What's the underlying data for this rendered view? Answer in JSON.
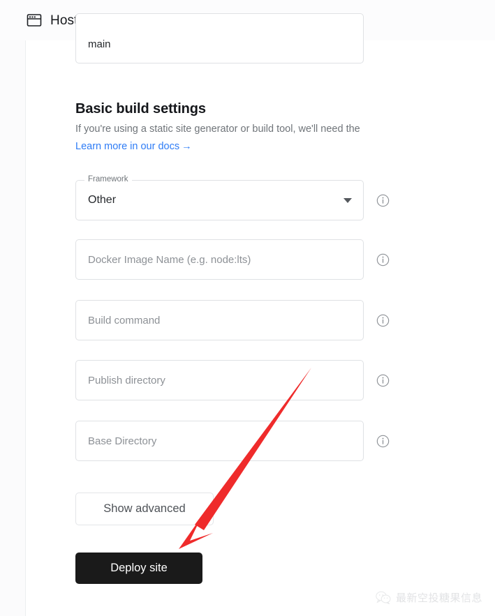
{
  "header": {
    "title": "Hosting",
    "icon": "browser-window-icon"
  },
  "clipped_field": {
    "value": "main"
  },
  "section": {
    "title": "Basic build settings",
    "description": "If you're using a static site generator or build tool, we'll need the",
    "docs_link_label": "Learn more in our docs",
    "docs_link_arrow": "→",
    "link_color": "#2e7cf6"
  },
  "fields": [
    {
      "name": "framework",
      "type": "select",
      "label": "Framework",
      "value": "Other",
      "caret": "chevron-down-icon",
      "info": "info-icon"
    },
    {
      "name": "docker-image-name",
      "type": "text",
      "placeholder": "Docker Image Name (e.g. node:lts)",
      "value": "",
      "info": "info-icon"
    },
    {
      "name": "build-command",
      "type": "text",
      "placeholder": "Build command",
      "value": "",
      "info": "info-icon"
    },
    {
      "name": "publish-directory",
      "type": "text",
      "placeholder": "Publish directory",
      "value": "",
      "info": "info-icon"
    },
    {
      "name": "base-directory",
      "type": "text",
      "placeholder": "Base Directory",
      "value": "",
      "info": "info-icon"
    }
  ],
  "buttons": {
    "show_advanced": "Show advanced",
    "deploy_site": "Deploy site",
    "deploy_bg": "#1a1a1a"
  },
  "annotation": {
    "type": "arrow",
    "color": "#ef2b2b",
    "points_to": "deploy-site-button"
  },
  "watermark": {
    "text": "最新空投糖果信息",
    "logo": "wechat-icon"
  }
}
